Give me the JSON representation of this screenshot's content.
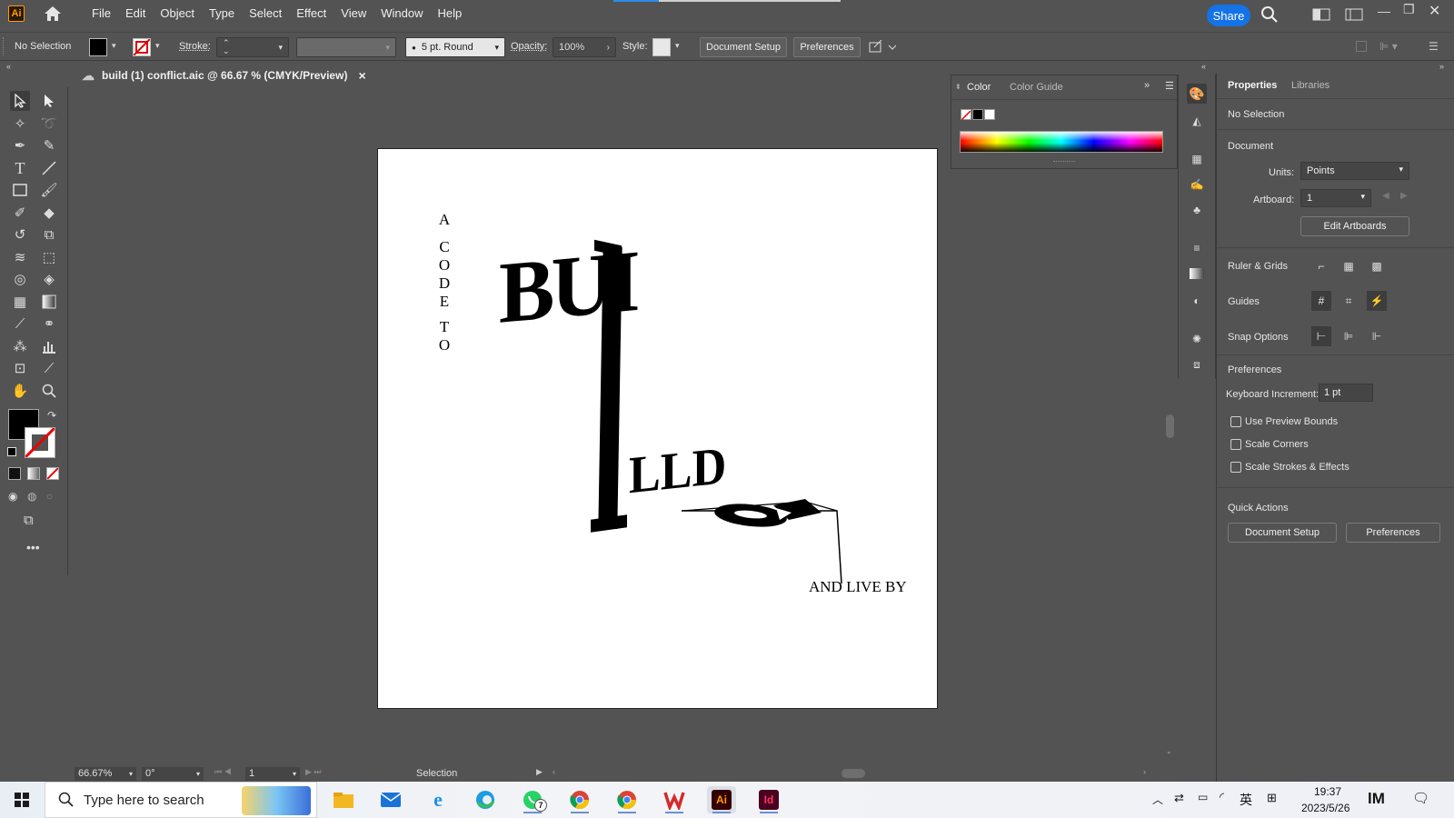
{
  "menubar": {
    "logo": "Ai",
    "items": [
      "File",
      "Edit",
      "Object",
      "Type",
      "Select",
      "Effect",
      "View",
      "Window",
      "Help"
    ],
    "share_label": "Share"
  },
  "control_bar": {
    "selection": "No Selection",
    "stroke_label": "Stroke:",
    "brush": "5 pt. Round",
    "opacity_label": "Opacity:",
    "opacity_value": "100%",
    "style_label": "Style:",
    "document_setup": "Document Setup",
    "preferences": "Preferences"
  },
  "document_tab": {
    "title": "build (1) conflict.aic @ 66.67 % (CMYK/Preview)",
    "close": "×"
  },
  "artwork": {
    "vertical_letters": [
      "A",
      "",
      "C",
      "O",
      "D",
      "E",
      "",
      "T",
      "O"
    ],
    "big_word_top": "BUI",
    "big_word_bottom": "LLD",
    "tagline": "AND LIVE BY"
  },
  "color_panel": {
    "tabs": [
      "Color",
      "Color Guide"
    ],
    "active_tab": "Color"
  },
  "properties": {
    "tabs": [
      "Properties",
      "Libraries"
    ],
    "selection": "No Selection",
    "document_heading": "Document",
    "units_label": "Units:",
    "units_value": "Points",
    "artboard_label": "Artboard:",
    "artboard_value": "1",
    "edit_artboards": "Edit Artboards",
    "ruler_grids": "Ruler & Grids",
    "guides": "Guides",
    "snap_options": "Snap Options",
    "preferences_heading": "Preferences",
    "keyboard_increment_label": "Keyboard Increment:",
    "keyboard_increment_value": "1 pt",
    "checkboxes": [
      "Use Preview Bounds",
      "Scale Corners",
      "Scale Strokes & Effects"
    ],
    "quick_actions": "Quick Actions",
    "qa_document_setup": "Document Setup",
    "qa_preferences": "Preferences"
  },
  "status_bar": {
    "zoom": "66.67%",
    "rotation": "0°",
    "artboard_nav": "1",
    "tool": "Selection"
  },
  "taskbar": {
    "search_placeholder": "Type here to search",
    "time": "19:37",
    "date": "2023/5/26",
    "lang": "英",
    "whatsapp_badge": "7",
    "ai_label": "Ai",
    "id_label": "Id"
  },
  "colors": {
    "ui_bg": "#535353",
    "accent": "#1473e6",
    "ai_orange": "#ff9a00",
    "id_pink": "#ff3366"
  }
}
